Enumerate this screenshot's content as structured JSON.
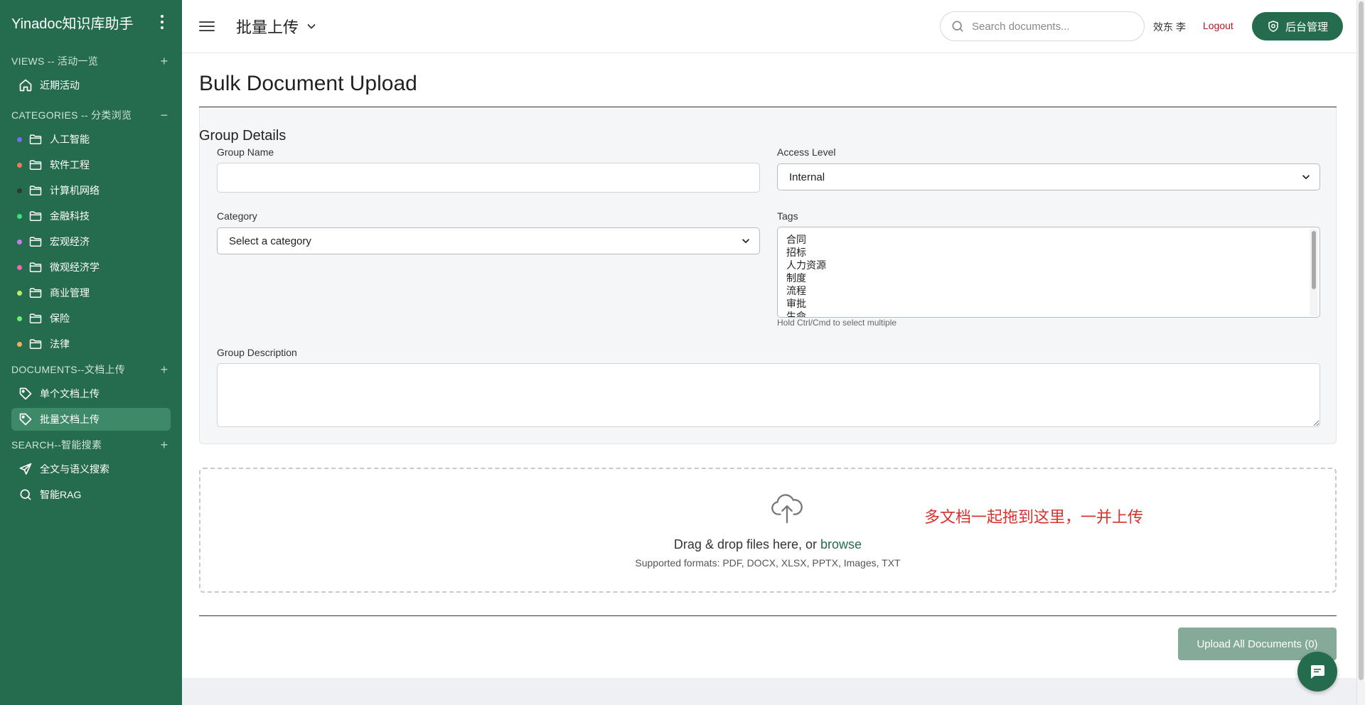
{
  "sidebar": {
    "brand": "Yinadoc知识库助手",
    "sections": {
      "views": {
        "title": "VIEWS -- 活动一览",
        "ctrl": "+",
        "items": [
          {
            "label": "近期活动",
            "icon": "home-icon"
          }
        ]
      },
      "categories": {
        "title": "CATEGORIES -- 分类浏览",
        "ctrl": "−",
        "items": [
          {
            "label": "人工智能",
            "color": "#7b6cf6"
          },
          {
            "label": "软件工程",
            "color": "#f07a5b"
          },
          {
            "label": "计算机网络",
            "color": "#2d3a33"
          },
          {
            "label": "金融科技",
            "color": "#3ee07a"
          },
          {
            "label": "宏观经济",
            "color": "#c77cf0"
          },
          {
            "label": "微观经济学",
            "color": "#f06ab0"
          },
          {
            "label": "商业管理",
            "color": "#b9f06a"
          },
          {
            "label": "保险",
            "color": "#6ef06a"
          },
          {
            "label": "法律",
            "color": "#f0b35a"
          }
        ]
      },
      "documents": {
        "title": "DOCUMENTS--文档上传",
        "ctrl": "+",
        "items": [
          {
            "label": "单个文档上传",
            "icon": "tag-icon"
          },
          {
            "label": "批量文档上传",
            "icon": "tag-icon",
            "active": true
          }
        ]
      },
      "search": {
        "title": "SEARCH--智能搜素",
        "ctrl": "+",
        "items": [
          {
            "label": "全文与语义搜索",
            "icon": "send-icon"
          },
          {
            "label": "智能RAG",
            "icon": "search-icon"
          }
        ]
      }
    }
  },
  "header": {
    "title": "批量上传",
    "search_placeholder": "Search documents...",
    "user": "效东 李",
    "logout": "Logout",
    "admin": "后台管理"
  },
  "main": {
    "heading": "Bulk Document Upload",
    "group": {
      "title": "Group Details",
      "name_label": "Group Name",
      "name_value": "",
      "access_label": "Access Level",
      "access_value": "Internal",
      "category_label": "Category",
      "category_value": "Select a category",
      "tags_label": "Tags",
      "tags": [
        "合同",
        "招标",
        "人力资源",
        "制度",
        "流程",
        "审批",
        "生命"
      ],
      "tags_hint": "Hold Ctrl/Cmd to select multiple",
      "desc_label": "Group Description",
      "desc_value": ""
    },
    "dropzone": {
      "note": "多文档一起拖到这里，一并上传",
      "text": "Drag & drop files here, or ",
      "browse": "browse",
      "formats": "Supported formats: PDF, DOCX, XLSX, PPTX, Images, TXT"
    },
    "upload_button": "Upload All Documents (0)"
  },
  "colors": {
    "brand": "#256b4e",
    "accent_red": "#d9312e",
    "logout": "#b0182a"
  }
}
